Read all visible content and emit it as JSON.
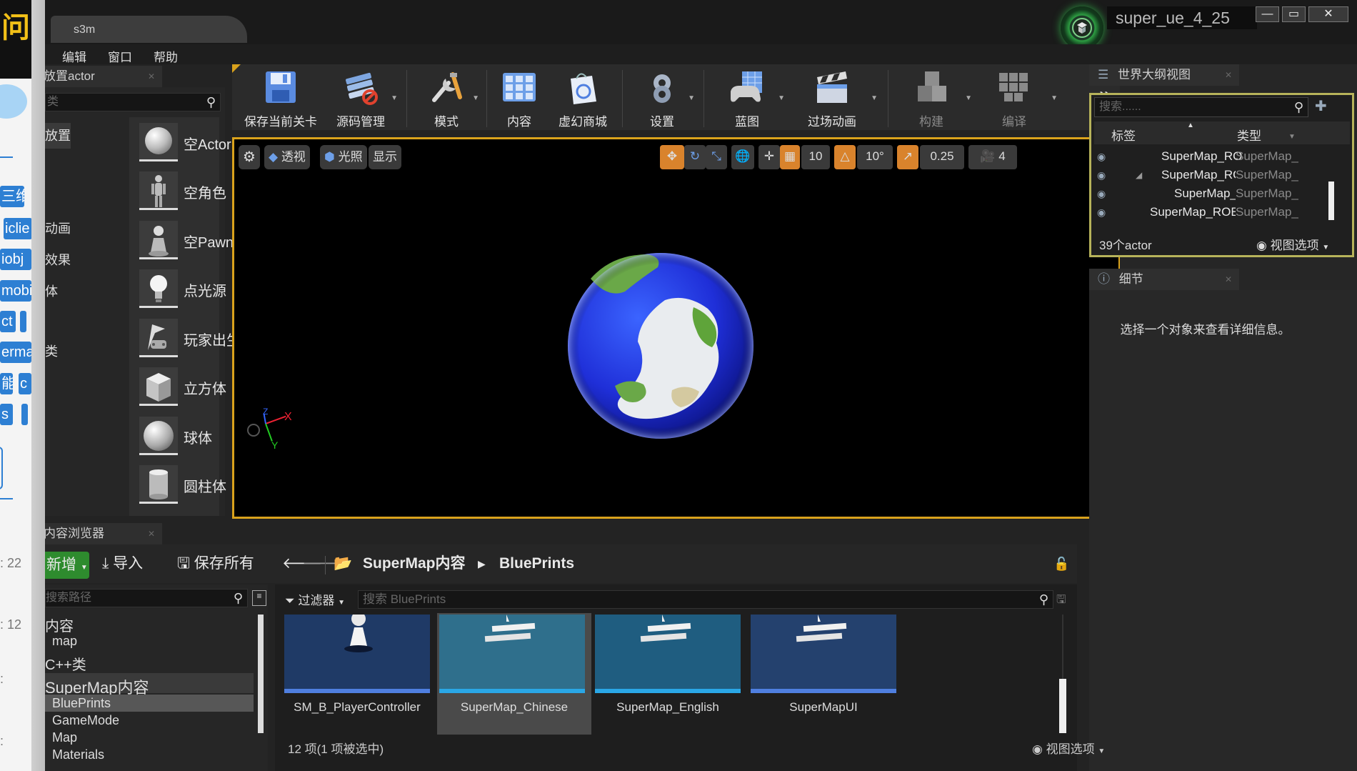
{
  "left_strip": {
    "chars_top": "问",
    "chips": [
      "三维",
      "iclie",
      "iobj",
      "mobi",
      "ct",
      "erma",
      "能",
      "c",
      "s"
    ],
    "numbers": [
      ": 22",
      ": 12",
      ":",
      ":"
    ]
  },
  "window": {
    "tab_title": "s3m",
    "project_name": "super_ue_4_25",
    "minimize": "—",
    "maximize": "▭",
    "close": "✕"
  },
  "menu": {
    "items": [
      "编辑",
      "窗口",
      "帮助"
    ]
  },
  "place_panel": {
    "title": "放置actor",
    "search_placeholder": "类",
    "categories": [
      "放置",
      "动画",
      "效果",
      "体",
      "类"
    ],
    "items": [
      {
        "label": "空Actor",
        "icon": "sphere-icon"
      },
      {
        "label": "空角色",
        "icon": "mannequin-icon"
      },
      {
        "label": "空Pawn",
        "icon": "pawn-icon"
      },
      {
        "label": "点光源",
        "icon": "light-bulb-icon"
      },
      {
        "label": "玩家出生点",
        "icon": "player-start-icon"
      },
      {
        "label": "立方体",
        "icon": "cube-icon"
      },
      {
        "label": "球体",
        "icon": "sphere-icon"
      },
      {
        "label": "圆柱体",
        "icon": "cylinder-icon"
      }
    ]
  },
  "toolbar": {
    "save": "保存当前关卡",
    "source_control": "源码管理",
    "modes": "模式",
    "content": "内容",
    "marketplace": "虚幻商城",
    "settings": "设置",
    "blueprints": "蓝图",
    "cinematics": "过场动画",
    "build": "构建",
    "compile": "编译",
    "more": "»"
  },
  "viewport": {
    "perspective": "透视",
    "lit": "光照",
    "show": "显示",
    "grid_snap": "10",
    "rotate_snap": "10°",
    "scale_snap": "0.25",
    "camera_speed": "4",
    "axis_x": "X",
    "axis_y": "Y",
    "axis_z": "Z",
    "accent": "#d9a21c"
  },
  "outliner": {
    "title": "世界大纲视图",
    "search_placeholder": "搜索......",
    "col_label": "标签",
    "col_type": "类型",
    "rows": [
      {
        "name": "SuperMap_ROEntity",
        "type": "SuperMap_"
      },
      {
        "name": "SuperMap_ROEntity",
        "type": "SuperMap_"
      },
      {
        "name": "SuperMap_ROEntity",
        "type": "SuperMap_"
      },
      {
        "name": "SuperMap_ROEntity",
        "type": "SuperMap_"
      }
    ],
    "count": "39个actor",
    "view_options": "视图选项"
  },
  "details": {
    "title": "细节",
    "empty_message": "选择一个对象来查看详细信息。"
  },
  "content_browser": {
    "title": "内容浏览器",
    "add_new": "新增",
    "import": "导入",
    "save_all": "保存所有",
    "path_root": "SuperMap内容",
    "path_current": "BluePrints",
    "path_search_placeholder": "搜索路径",
    "filters": "过滤器",
    "asset_search_placeholder": "搜索 BluePrints",
    "tree": [
      {
        "label": "内容",
        "level": 0
      },
      {
        "label": "map",
        "level": 1
      },
      {
        "label": "C++类",
        "level": 0
      },
      {
        "label": "SuperMap内容",
        "level": 0
      },
      {
        "label": "BluePrints",
        "level": 1
      },
      {
        "label": "GameMode",
        "level": 1
      },
      {
        "label": "Map",
        "level": 1
      },
      {
        "label": "Materials",
        "level": 1
      }
    ],
    "assets": [
      {
        "label": "SM_B_PlayerController",
        "color": "#1f3a66"
      },
      {
        "label": "SuperMap_Chinese",
        "color": "#2f6f8c"
      },
      {
        "label": "SuperMap_English",
        "color": "#1f5d80"
      },
      {
        "label": "SuperMapUI",
        "color": "#24416e"
      }
    ],
    "status": "12 项(1 项被选中)",
    "view_options": "视图选项"
  }
}
